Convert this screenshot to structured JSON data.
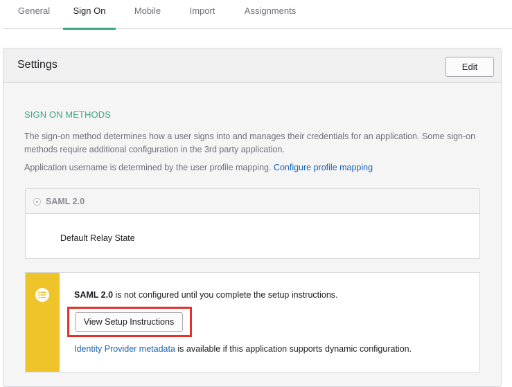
{
  "tabs": [
    {
      "label": "General"
    },
    {
      "label": "Sign On",
      "active": true
    },
    {
      "label": "Mobile"
    },
    {
      "label": "Import"
    },
    {
      "label": "Assignments"
    }
  ],
  "settings": {
    "title": "Settings",
    "edit_label": "Edit",
    "section_heading": "SIGN ON METHODS",
    "description": "The sign-on method determines how a user signs into and manages their credentials for an application. Some sign-on methods require additional configuration in the 3rd party application.",
    "username_text": "Application username is determined by the user profile mapping. ",
    "username_link": "Configure profile mapping"
  },
  "saml": {
    "label": "SAML 2.0",
    "relay_state_label": "Default Relay State"
  },
  "warning": {
    "bold": "SAML 2.0",
    "text": " is not configured until you complete the setup instructions.",
    "button_label": "View Setup Instructions",
    "idp_link": "Identity Provider metadata",
    "idp_text": " is available if this application supports dynamic configuration."
  },
  "colors": {
    "accent": "#3ba584",
    "link": "#1662b0",
    "warning": "#efc42a",
    "highlight": "#e8302a"
  }
}
